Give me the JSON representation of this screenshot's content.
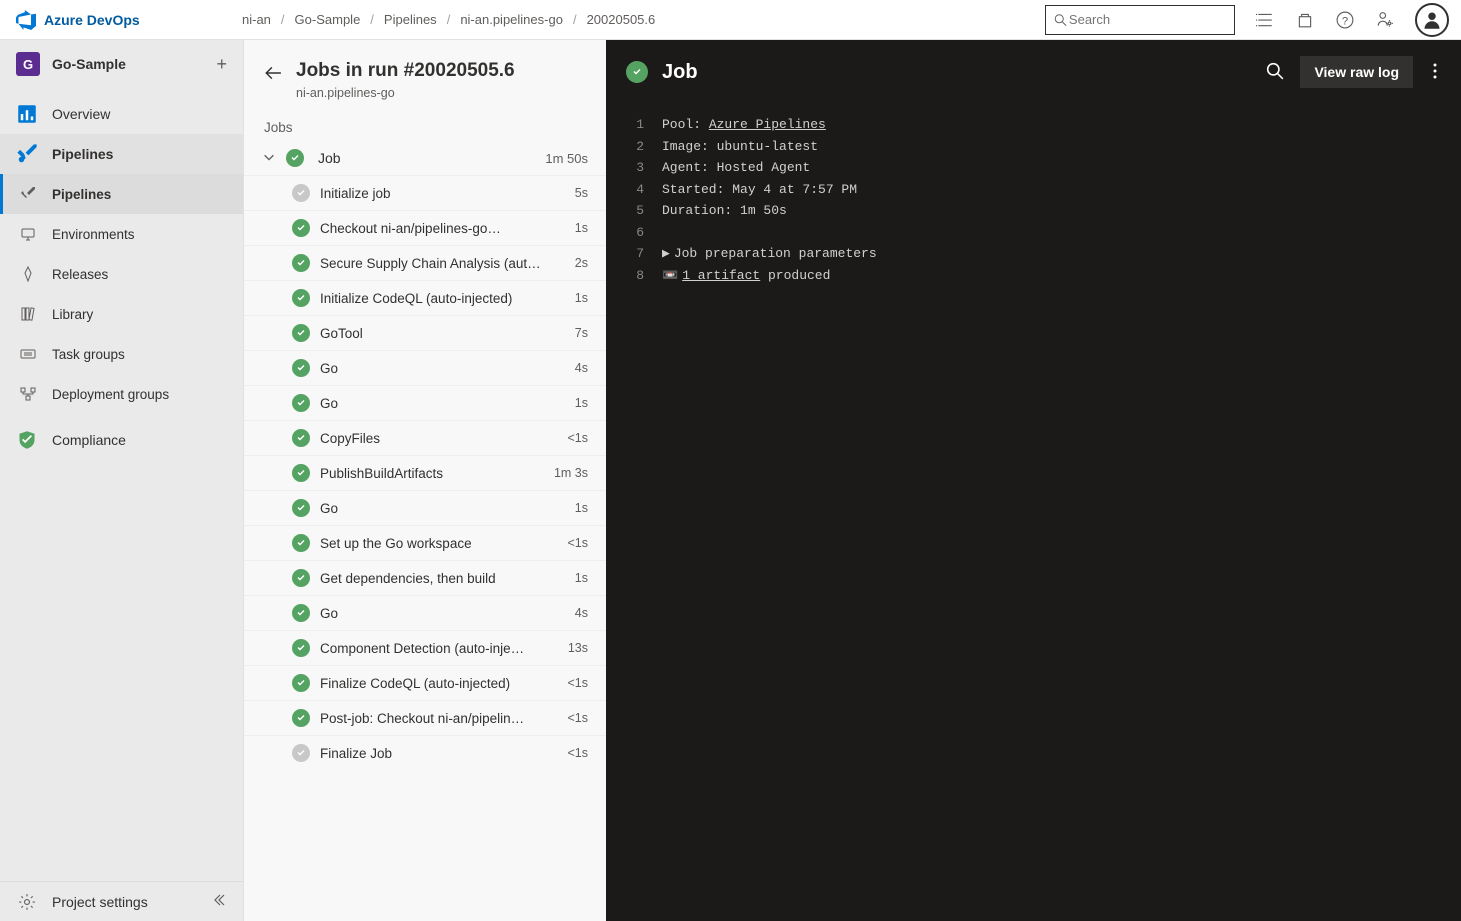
{
  "brand": "Azure DevOps",
  "breadcrumb": [
    "ni-an",
    "Go-Sample",
    "Pipelines",
    "ni-an.pipelines-go",
    "20020505.6"
  ],
  "search": {
    "placeholder": "Search"
  },
  "project": {
    "initial": "G",
    "name": "Go-Sample"
  },
  "side_nav": {
    "overview": "Overview",
    "pipelines_group": "Pipelines",
    "items": [
      {
        "label": "Pipelines",
        "icon": "pipelines"
      },
      {
        "label": "Environments",
        "icon": "environments"
      },
      {
        "label": "Releases",
        "icon": "releases"
      },
      {
        "label": "Library",
        "icon": "library"
      },
      {
        "label": "Task groups",
        "icon": "taskgroups"
      },
      {
        "label": "Deployment groups",
        "icon": "deployment"
      }
    ],
    "compliance": "Compliance",
    "project_settings": "Project settings"
  },
  "run": {
    "title": "Jobs in run #20020505.6",
    "pipeline": "ni-an.pipelines-go",
    "jobs_label": "Jobs",
    "job_name": "Job",
    "job_duration": "1m 50s"
  },
  "steps": [
    {
      "status": "skipped",
      "name": "Initialize job",
      "dur": "5s"
    },
    {
      "status": "success",
      "name": "Checkout ni-an/pipelines-go…",
      "dur": "1s"
    },
    {
      "status": "success",
      "name": "Secure Supply Chain Analysis (aut…",
      "dur": "2s"
    },
    {
      "status": "success",
      "name": "Initialize CodeQL (auto-injected)",
      "dur": "1s"
    },
    {
      "status": "success",
      "name": "GoTool",
      "dur": "7s"
    },
    {
      "status": "success",
      "name": "Go",
      "dur": "4s"
    },
    {
      "status": "success",
      "name": "Go",
      "dur": "1s"
    },
    {
      "status": "success",
      "name": "CopyFiles",
      "dur": "<1s"
    },
    {
      "status": "success",
      "name": "PublishBuildArtifacts",
      "dur": "1m 3s"
    },
    {
      "status": "success",
      "name": "Go",
      "dur": "1s"
    },
    {
      "status": "success",
      "name": "Set up the Go workspace",
      "dur": "<1s"
    },
    {
      "status": "success",
      "name": "Get dependencies, then build",
      "dur": "1s"
    },
    {
      "status": "success",
      "name": "Go",
      "dur": "4s"
    },
    {
      "status": "success",
      "name": "Component Detection (auto-inje…",
      "dur": "13s"
    },
    {
      "status": "success",
      "name": "Finalize CodeQL (auto-injected)",
      "dur": "<1s"
    },
    {
      "status": "success",
      "name": "Post-job: Checkout ni-an/pipelin…",
      "dur": "<1s"
    },
    {
      "status": "skipped",
      "name": "Finalize Job",
      "dur": "<1s"
    }
  ],
  "log_header": {
    "title": "Job",
    "raw_log": "View raw log"
  },
  "log_lines": [
    {
      "n": 1,
      "key": "Pool: ",
      "link": "Azure Pipelines"
    },
    {
      "n": 2,
      "text": "Image: ubuntu-latest"
    },
    {
      "n": 3,
      "text": "Agent: Hosted Agent"
    },
    {
      "n": 4,
      "text": "Started: May 4 at 7:57 PM"
    },
    {
      "n": 5,
      "text": "Duration: 1m 50s"
    },
    {
      "n": 6,
      "text": ""
    },
    {
      "n": 7,
      "fold": true,
      "text": "Job preparation parameters"
    },
    {
      "n": 8,
      "artifact": true,
      "text_before": "",
      "link": "1 artifact",
      "text_after": " produced"
    }
  ]
}
